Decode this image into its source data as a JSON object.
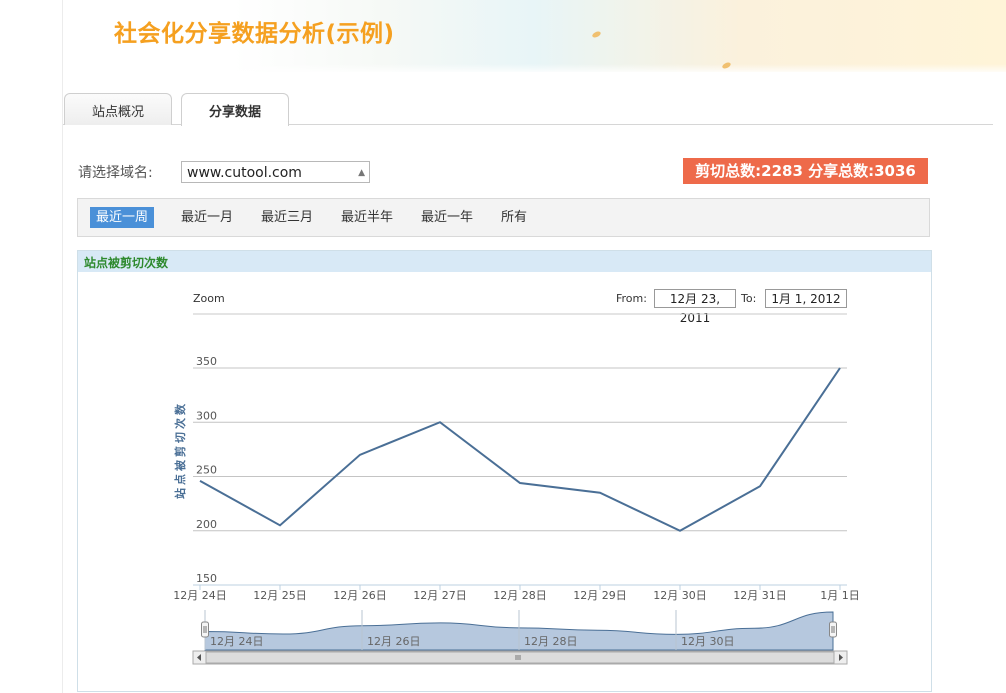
{
  "header": {
    "title": "社会化分享数据分析(示例)"
  },
  "tabs": [
    {
      "label": "站点概况",
      "active": false
    },
    {
      "label": "分享数据",
      "active": true
    }
  ],
  "domain": {
    "label": "请选择域名:",
    "selected": "www.cutool.com"
  },
  "totals": {
    "text": "剪切总数:2283 分享总数:3036"
  },
  "ranges": [
    {
      "label": "最近一周",
      "active": true
    },
    {
      "label": "最近一月",
      "active": false
    },
    {
      "label": "最近三月",
      "active": false
    },
    {
      "label": "最近半年",
      "active": false
    },
    {
      "label": "最近一年",
      "active": false
    },
    {
      "label": "所有",
      "active": false
    }
  ],
  "panel": {
    "title": "站点被剪切次数"
  },
  "zoom": {
    "label": "Zoom",
    "from_label": "From:",
    "from_value": "12月 23, 2011",
    "to_label": "To:",
    "to_value": "1月 1, 2012"
  },
  "colors": {
    "accent": "#4a90d8",
    "totals_bg": "#ee6a4a",
    "title": "#f5a020",
    "line": "#4a6f96",
    "navigator_fill": "#a9bed8"
  },
  "chart_data": {
    "type": "line",
    "ylabel": "站点被剪切次数",
    "categories": [
      "12月 24日",
      "12月 25日",
      "12月 26日",
      "12月 27日",
      "12月 28日",
      "12月 29日",
      "12月 30日",
      "12月 31日",
      "1月 1日"
    ],
    "values": [
      246,
      205,
      270,
      300,
      244,
      235,
      200,
      241,
      350
    ],
    "ylim": [
      150,
      350
    ],
    "yticks": [
      150,
      200,
      250,
      300,
      350
    ],
    "grid": true,
    "navigator_labels": [
      "12月 24日",
      "12月 26日",
      "12月 28日",
      "12月 30日"
    ],
    "navigator_values": [
      240,
      228,
      268,
      282,
      258,
      246,
      226,
      256,
      335
    ]
  }
}
